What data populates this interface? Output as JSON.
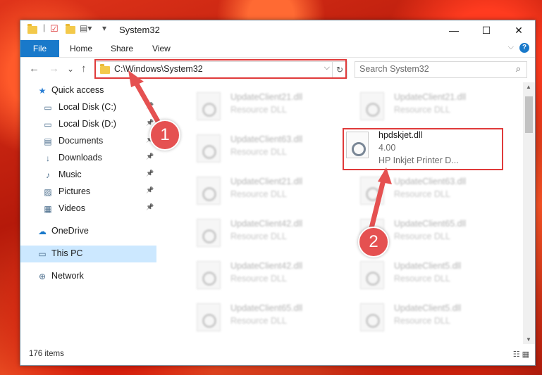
{
  "window": {
    "title": "System32"
  },
  "titlebar": {
    "minimize": "—",
    "maximize": "☐",
    "close": "✕"
  },
  "ribbon": {
    "file": "File",
    "tabs": [
      "Home",
      "Share",
      "View"
    ],
    "help": "?",
    "expand": "⌵"
  },
  "nav": {
    "back": "←",
    "forward": "→",
    "recent": "⌄",
    "up": "↑"
  },
  "address": {
    "path": "C:\\Windows\\System32",
    "dropdown": "⌵",
    "refresh": "↻"
  },
  "search": {
    "placeholder": "Search System32",
    "icon": "⌕"
  },
  "sidebar": {
    "items": [
      {
        "label": "Quick access",
        "icon": "★",
        "top": true
      },
      {
        "label": "Local Disk (C:)",
        "icon": "▭",
        "pinned": true
      },
      {
        "label": "Local Disk (D:)",
        "icon": "▭",
        "pinned": true
      },
      {
        "label": "Documents",
        "icon": "▤",
        "pinned": true
      },
      {
        "label": "Downloads",
        "icon": "↓",
        "pinned": true
      },
      {
        "label": "Music",
        "icon": "♪",
        "pinned": true
      },
      {
        "label": "Pictures",
        "icon": "▨",
        "pinned": true
      },
      {
        "label": "Videos",
        "icon": "▦",
        "pinned": true
      },
      {
        "label": "OneDrive",
        "icon": "☁",
        "top": true
      },
      {
        "label": "This PC",
        "icon": "▭",
        "top": true,
        "selected": true
      },
      {
        "label": "Network",
        "icon": "⊕",
        "top": true
      }
    ]
  },
  "files": [
    {
      "name": "UpdateClient21.dll",
      "desc": "Resource DLL"
    },
    {
      "name": "UpdateClient21.dll",
      "desc": "Resource DLL"
    },
    {
      "name": "UpdateClient63.dll",
      "desc": "Resource DLL"
    },
    {
      "name": "hpdskjet.dll",
      "desc": "4.00",
      "desc2": "HP Inkjet Printer D...",
      "focus": true
    },
    {
      "name": "UpdateClient21.dll",
      "desc": "Resource DLL"
    },
    {
      "name": "UpdateClient63.dll",
      "desc": "Resource DLL"
    },
    {
      "name": "UpdateClient42.dll",
      "desc": "Resource DLL"
    },
    {
      "name": "UpdateClient65.dll",
      "desc": "Resource DLL"
    },
    {
      "name": "UpdateClient42.dll",
      "desc": "Resource DLL"
    },
    {
      "name": "UpdateClient5.dll",
      "desc": "Resource DLL"
    },
    {
      "name": "UpdateClient65.dll",
      "desc": "Resource DLL"
    },
    {
      "name": "UpdateClient5.dll",
      "desc": "Resource DLL"
    }
  ],
  "status": {
    "items": "176 items",
    "views": "☷ ▦"
  },
  "annotations": {
    "step1": "1",
    "step2": "2",
    "color": "#e55151"
  }
}
